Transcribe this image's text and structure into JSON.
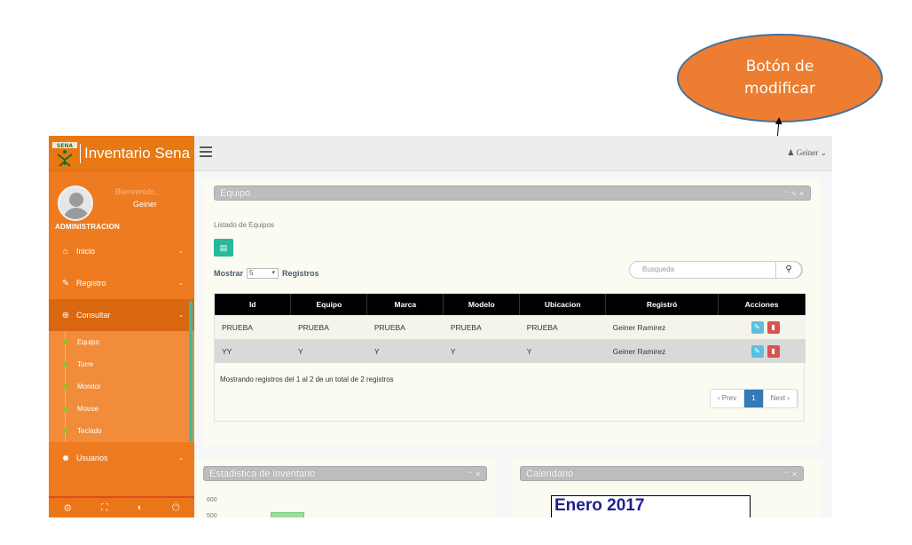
{
  "annotation": {
    "line1": "Botón de",
    "line2": "modificar"
  },
  "brand": {
    "title": "Inventario Sena"
  },
  "profile": {
    "welcome": "Bienvenido,",
    "name": "Geiner",
    "role": "ADMINISTRACION"
  },
  "nav": {
    "inicio": "Inicio",
    "registro": "Registro",
    "consultar": "Consultar",
    "sub": [
      "Equipo",
      "Torre",
      "Monitor",
      "Mouse",
      "Teclado"
    ],
    "usuarios": "Usuarios"
  },
  "topbar": {
    "user": "Geiner"
  },
  "panel_equipo": {
    "title": "Equipo",
    "subtitle": "Listado de Equipos",
    "mostrar": "Mostrar",
    "page_size": "5",
    "registros": "Registros",
    "search_placeholder": "Busqueda",
    "columns": [
      "Id",
      "Equipo",
      "Marca",
      "Modelo",
      "Ubicacion",
      "Registró",
      "Acciones"
    ],
    "rows": [
      [
        "PRUEBA",
        "PRUEBA",
        "PRUEBA",
        "PRUEBA",
        "PRUEBA",
        "Geiner Ramirez"
      ],
      [
        "YY",
        "Y",
        "Y",
        "Y",
        "Y",
        "Geiner Ramirez"
      ]
    ],
    "showing": "Mostrando registros del 1 al 2 de un total de 2 registros",
    "pager": {
      "prev": "‹ Prev",
      "current": "1",
      "next": "Next ›"
    }
  },
  "panel_chart": {
    "title": "Estadistica de inventario",
    "yticks": [
      "600",
      "500"
    ]
  },
  "panel_cal": {
    "title": "Calendario",
    "month": "Enero 2017"
  },
  "colors": {
    "sidebar": "#ee7b1f",
    "accent": "#26b99a",
    "edit": "#5bc0de",
    "delete": "#d9534f"
  }
}
